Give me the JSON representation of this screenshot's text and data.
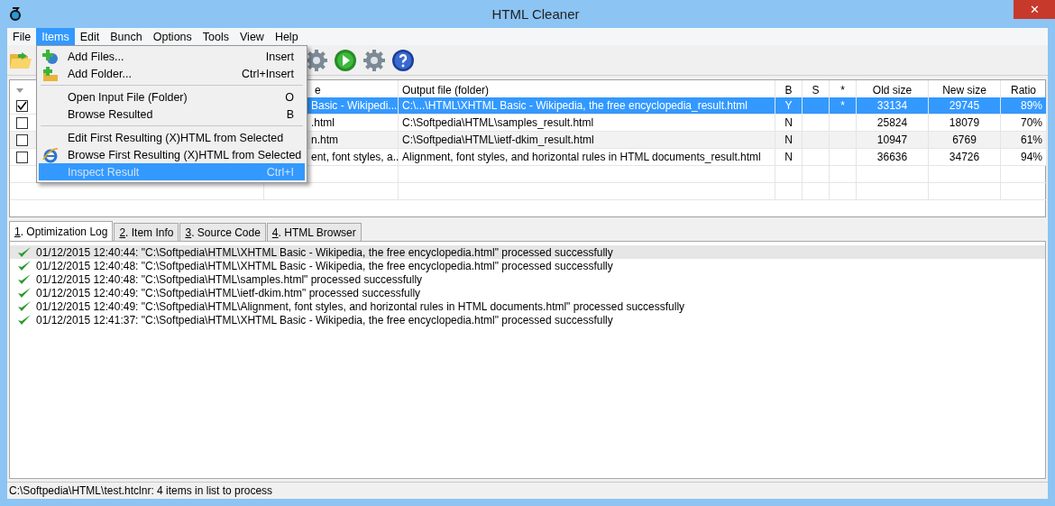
{
  "window": {
    "title": "HTML Cleaner",
    "close": "✕"
  },
  "menubar": [
    {
      "label": "File",
      "selected": false
    },
    {
      "label": "Items",
      "selected": true
    },
    {
      "label": "Edit",
      "selected": false
    },
    {
      "label": "Bunch",
      "selected": false
    },
    {
      "label": "Options",
      "selected": false
    },
    {
      "label": "Tools",
      "selected": false
    },
    {
      "label": "View",
      "selected": false
    },
    {
      "label": "Help",
      "selected": false
    }
  ],
  "items_menu": [
    {
      "kind": "item",
      "label": "Add Files...",
      "shortcut": "Insert",
      "selected": false,
      "disabled": false
    },
    {
      "kind": "item",
      "label": "Add Folder...",
      "shortcut": "Ctrl+Insert",
      "selected": false,
      "disabled": false
    },
    {
      "kind": "separator"
    },
    {
      "kind": "item",
      "label": "Open Input File (Folder)",
      "shortcut": "O",
      "selected": false,
      "disabled": false
    },
    {
      "kind": "item",
      "label": "Browse Resulted",
      "shortcut": "B",
      "selected": false,
      "disabled": false
    },
    {
      "kind": "separator"
    },
    {
      "kind": "item",
      "label": "Edit First Resulting (X)HTML from Selected",
      "selected": false,
      "disabled": false
    },
    {
      "kind": "item",
      "label": "Browse First Resulting (X)HTML from Selected",
      "selected": false,
      "disabled": false
    },
    {
      "kind": "item",
      "label": "Inspect Result",
      "shortcut": "Ctrl+I",
      "selected": true,
      "disabled": true
    }
  ],
  "table": {
    "columns": [
      "e",
      "Output file (folder)",
      "B",
      "S",
      "*",
      "Old size",
      "New size",
      "Ratio"
    ],
    "rows": [
      {
        "checked": true,
        "selected": true,
        "input": "Basic - Wikipedi...",
        "output": "C:\\...\\HTML\\XHTML Basic - Wikipedia, the free encyclopedia_result.html",
        "b": "Y",
        "s": "",
        "star": "*",
        "old": "33134",
        "new": "29745",
        "ratio": "89%"
      },
      {
        "checked": false,
        "selected": false,
        "input": ".html",
        "output": "C:\\Softpedia\\HTML\\samples_result.html",
        "b": "N",
        "s": "",
        "star": "",
        "old": "25824",
        "new": "18079",
        "ratio": "70%"
      },
      {
        "checked": false,
        "selected": false,
        "input": "n.htm",
        "output": "C:\\Softpedia\\HTML\\ietf-dkim_result.html",
        "b": "N",
        "s": "",
        "star": "",
        "old": "10947",
        "new": "6769",
        "ratio": "61%"
      },
      {
        "checked": false,
        "selected": false,
        "input": "ent, font styles, a...",
        "output": "Alignment, font styles, and horizontal rules in HTML documents_result.html",
        "b": "N",
        "s": "",
        "star": "",
        "old": "36636",
        "new": "34726",
        "ratio": "94%"
      }
    ]
  },
  "tabs": [
    {
      "key": "1",
      "label": ". Optimization Log",
      "selected": true
    },
    {
      "key": "2",
      "label": ". Item Info",
      "selected": false
    },
    {
      "key": "3",
      "label": ". Source Code",
      "selected": false
    },
    {
      "key": "4",
      "label": ". HTML Browser",
      "selected": false
    }
  ],
  "log": [
    {
      "text": "01/12/2015 12:40:44: \"C:\\Softpedia\\HTML\\XHTML Basic - Wikipedia, the free encyclopedia.html\" processed successfully",
      "selected": true
    },
    {
      "text": "01/12/2015 12:40:48: \"C:\\Softpedia\\HTML\\XHTML Basic - Wikipedia, the free encyclopedia.html\" processed successfully",
      "selected": false
    },
    {
      "text": "01/12/2015 12:40:48: \"C:\\Softpedia\\HTML\\samples.html\" processed successfully",
      "selected": false
    },
    {
      "text": "01/12/2015 12:40:49: \"C:\\Softpedia\\HTML\\ietf-dkim.htm\" processed successfully",
      "selected": false
    },
    {
      "text": "01/12/2015 12:40:49: \"C:\\Softpedia\\HTML\\Alignment, font styles, and horizontal rules in HTML documents.html\" processed successfully",
      "selected": false
    },
    {
      "text": "01/12/2015 12:41:37: \"C:\\Softpedia\\HTML\\XHTML Basic - Wikipedia, the free encyclopedia.html\" processed successfully",
      "selected": false
    }
  ],
  "status_bar": "C:\\Softpedia\\HTML\\test.htclnr: 4 items in list to process"
}
